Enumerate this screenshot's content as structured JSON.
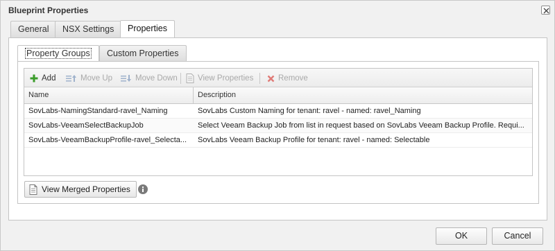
{
  "dialog": {
    "title": "Blueprint Properties"
  },
  "tabs": [
    {
      "label": "General"
    },
    {
      "label": "NSX Settings"
    },
    {
      "label": "Properties"
    }
  ],
  "inner_tabs": [
    {
      "label": "Property Groups"
    },
    {
      "label": "Custom Properties"
    }
  ],
  "toolbar": {
    "add": "Add",
    "move_up": "Move Up",
    "move_down": "Move Down",
    "view_properties": "View Properties",
    "remove": "Remove"
  },
  "grid": {
    "columns": [
      "Name",
      "Description"
    ],
    "rows": [
      {
        "name": "SovLabs-NamingStandard-ravel_Naming",
        "description": "SovLabs Custom Naming for tenant: ravel - named: ravel_Naming"
      },
      {
        "name": "SovLabs-VeeamSelectBackupJob",
        "description": "Select Veeam Backup Job from list in request based on SovLabs Veeam Backup Profile. Requi..."
      },
      {
        "name": "SovLabs-VeeamBackupProfile-ravel_Selecta...",
        "description": "SovLabs Veeam Backup Profile for tenant: ravel - named: Selectable"
      }
    ]
  },
  "view_merged_label": "View Merged Properties",
  "footer": {
    "ok": "OK",
    "cancel": "Cancel"
  },
  "colors": {
    "add_icon": "#3a9c2a",
    "remove_icon": "#d9534f",
    "disabled_text": "#a9a9a9"
  }
}
